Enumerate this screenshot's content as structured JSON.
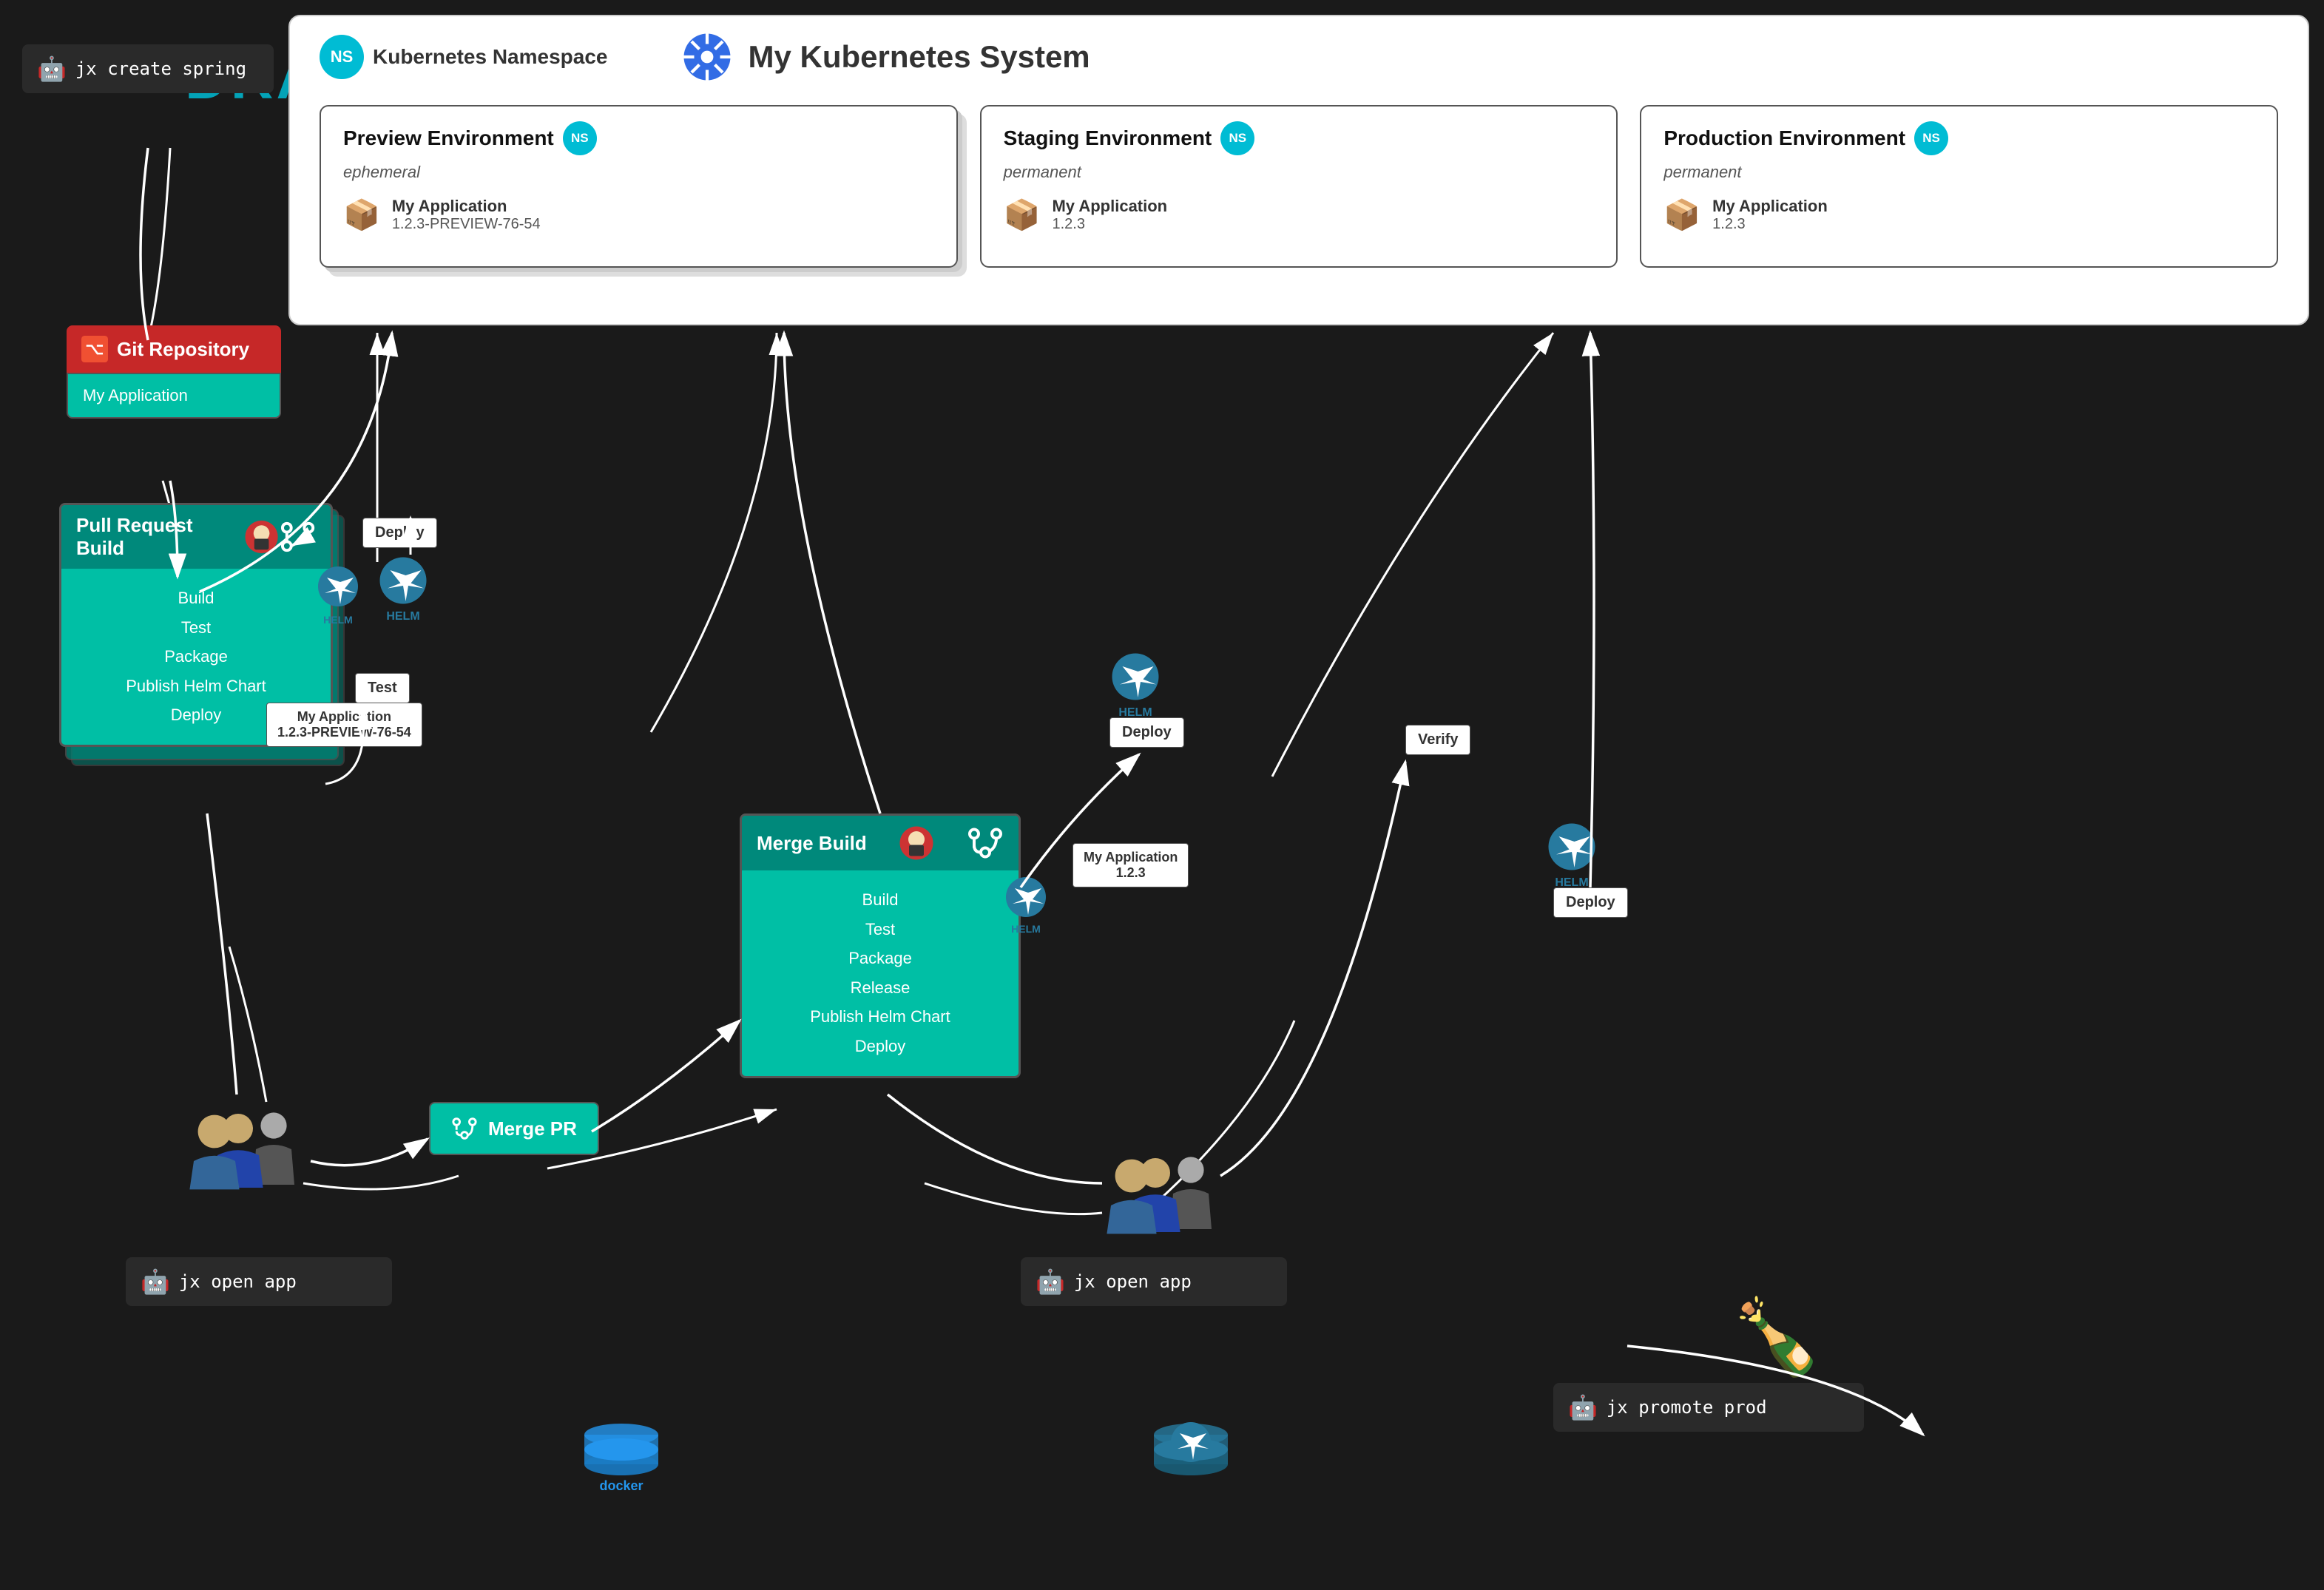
{
  "kubernetes": {
    "namespace_label": "Kubernetes Namespace",
    "title": "My Kubernetes System",
    "environments": [
      {
        "name": "Preview Environment",
        "type": "ephemeral",
        "app_name": "My Application",
        "app_version": "1.2.3-PREVIEW-76-54",
        "stacked": true
      },
      {
        "name": "Staging Environment",
        "type": "permanent",
        "app_name": "My Application",
        "app_version": "1.2.3",
        "stacked": false
      },
      {
        "name": "Production Environment",
        "type": "permanent",
        "app_name": "My Application",
        "app_version": "1.2.3",
        "stacked": false
      }
    ]
  },
  "draft": "DRAFT",
  "git_repo": {
    "title": "Git Repository",
    "app": "My Application"
  },
  "pull_request_build": {
    "title": "Pull Request Build",
    "steps": [
      "Build",
      "Test",
      "Package",
      "Publish Helm Chart",
      "Deploy"
    ]
  },
  "merge_build": {
    "title": "Merge Build",
    "steps": [
      "Build",
      "Test",
      "Package",
      "Release",
      "Publish Helm Chart",
      "Deploy"
    ]
  },
  "commands": {
    "create_spring": "jx create spring",
    "open_app_1": "jx open app",
    "open_app_2": "jx open app",
    "promote_prod": "jx promote prod"
  },
  "merge_pr": "Merge PR",
  "labels": {
    "deploy1": "Deploy",
    "test": "Test",
    "deploy2": "Deploy",
    "verify": "Verify",
    "deploy3": "Deploy",
    "app_version_preview": "My Application\n1.2.3-PREVIEW-76-54",
    "app_version_staging": "My Application\n1.2.3"
  }
}
